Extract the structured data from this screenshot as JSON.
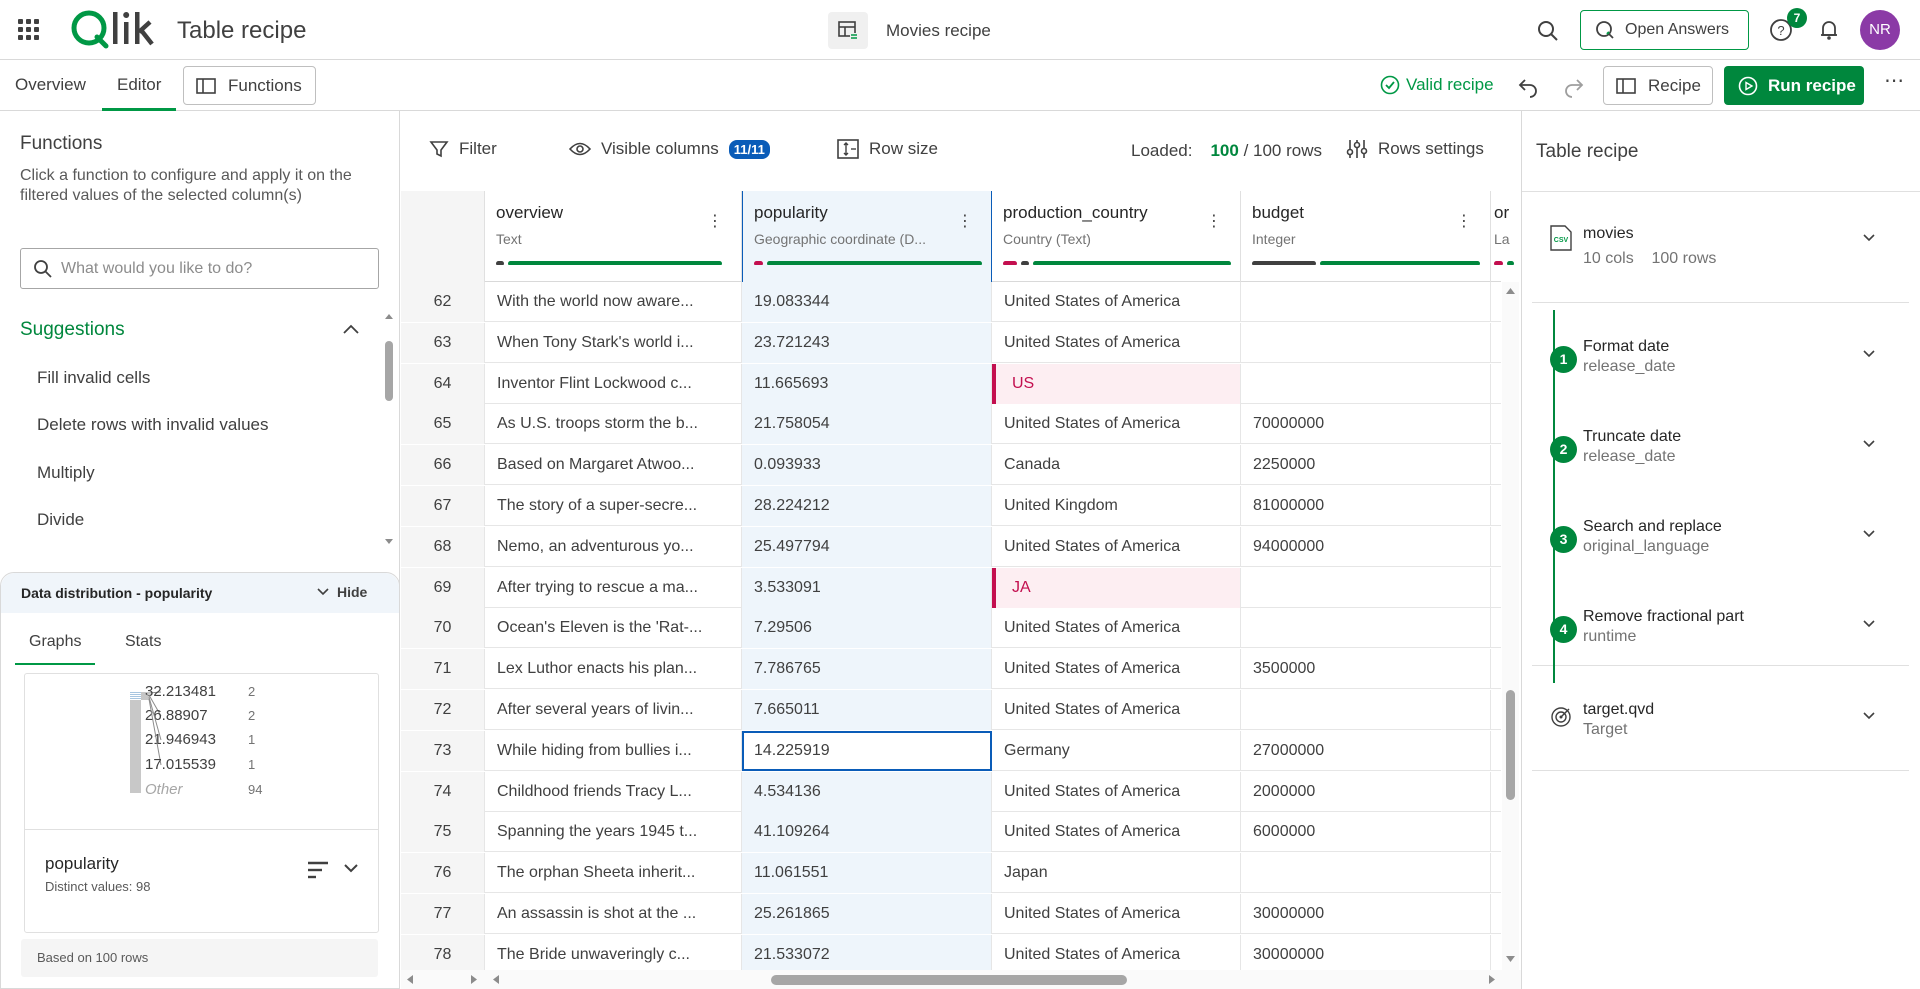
{
  "header": {
    "app_title": "Table recipe",
    "doc_title": "Movies recipe",
    "open_answers": "Open Answers",
    "help_badge": "7",
    "avatar_initials": "NR"
  },
  "subbar": {
    "tab_overview": "Overview",
    "tab_editor": "Editor",
    "functions": "Functions",
    "valid_recipe": "Valid recipe",
    "recipe": "Recipe",
    "run_recipe": "Run recipe"
  },
  "left_panel": {
    "title": "Functions",
    "description": "Click a function to configure and apply it on the filtered values of the selected column(s)",
    "search_placeholder": "What would you like to do?",
    "suggestions_label": "Suggestions",
    "suggestions": [
      "Fill invalid cells",
      "Delete rows with invalid values",
      "Multiply",
      "Divide"
    ]
  },
  "distribution": {
    "title": "Data distribution - popularity",
    "hide": "Hide",
    "tab_graphs": "Graphs",
    "tab_stats": "Stats",
    "field_name": "popularity",
    "distinct": "Distinct values: 98",
    "footer": "Based on 100 rows",
    "chart_data": {
      "type": "bar",
      "categories": [
        "32.213481",
        "26.88907",
        "21.946943",
        "17.015539",
        "Other"
      ],
      "values": [
        2,
        2,
        1,
        1,
        94
      ],
      "labels": [
        "2",
        "2",
        "1",
        "1",
        "94"
      ]
    }
  },
  "toolbar": {
    "filter": "Filter",
    "visible_columns": "Visible columns",
    "visible_badge": "11/11",
    "row_size": "Row size",
    "loaded_label": "Loaded:",
    "loaded_count": "100",
    "loaded_total": "/ 100 rows",
    "rows_settings": "Rows settings"
  },
  "columns": [
    {
      "name": "overview",
      "type": "Text"
    },
    {
      "name": "popularity",
      "type": "Geographic coordinate (D..."
    },
    {
      "name": "production_country",
      "type": "Country (Text)"
    },
    {
      "name": "budget",
      "type": "Integer"
    },
    {
      "name": "or",
      "type": "La"
    }
  ],
  "rows": [
    {
      "num": "62",
      "overview": "With the world now aware...",
      "popularity": "19.083344",
      "country": "United States of America",
      "budget": ""
    },
    {
      "num": "63",
      "overview": "When Tony Stark's world i...",
      "popularity": "23.721243",
      "country": "United States of America",
      "budget": ""
    },
    {
      "num": "64",
      "overview": "Inventor Flint Lockwood c...",
      "popularity": "11.665693",
      "country": "US",
      "budget": ""
    },
    {
      "num": "65",
      "overview": "As U.S. troops storm the b...",
      "popularity": "21.758054",
      "country": "United States of America",
      "budget": "70000000"
    },
    {
      "num": "66",
      "overview": "Based on Margaret Atwoo...",
      "popularity": "0.093933",
      "country": "Canada",
      "budget": "2250000"
    },
    {
      "num": "67",
      "overview": "The story of a super-secre...",
      "popularity": "28.224212",
      "country": "United Kingdom",
      "budget": "81000000"
    },
    {
      "num": "68",
      "overview": "Nemo, an adventurous yo...",
      "popularity": "25.497794",
      "country": "United States of America",
      "budget": "94000000"
    },
    {
      "num": "69",
      "overview": "After trying to rescue a ma...",
      "popularity": "3.533091",
      "country": "JA",
      "budget": ""
    },
    {
      "num": "70",
      "overview": "Ocean's Eleven is the 'Rat-...",
      "popularity": "7.29506",
      "country": "United States of America",
      "budget": ""
    },
    {
      "num": "71",
      "overview": "Lex Luthor enacts his plan...",
      "popularity": "7.786765",
      "country": "United States of America",
      "budget": "3500000"
    },
    {
      "num": "72",
      "overview": "After several years of livin...",
      "popularity": "7.665011",
      "country": "United States of America",
      "budget": ""
    },
    {
      "num": "73",
      "overview": "While hiding from bullies i...",
      "popularity": "14.225919",
      "country": "Germany",
      "budget": "27000000"
    },
    {
      "num": "74",
      "overview": "Childhood friends Tracy L...",
      "popularity": "4.534136",
      "country": "United States of America",
      "budget": "2000000"
    },
    {
      "num": "75",
      "overview": "Spanning the years 1945 t...",
      "popularity": "41.109264",
      "country": "United States of America",
      "budget": "6000000"
    },
    {
      "num": "76",
      "overview": "The orphan Sheeta inherit...",
      "popularity": "11.061551",
      "country": "Japan",
      "budget": ""
    },
    {
      "num": "77",
      "overview": "An assassin is shot at the ...",
      "popularity": "25.261865",
      "country": "United States of America",
      "budget": "30000000"
    },
    {
      "num": "78",
      "overview": "The Bride unwaveringly c...",
      "popularity": "21.533072",
      "country": "United States of America",
      "budget": "30000000"
    }
  ],
  "right_panel": {
    "title": "Table recipe",
    "source": {
      "name": "movies",
      "cols": "10 cols",
      "rows": "100 rows",
      "icon_text": "CSV"
    },
    "steps": [
      {
        "num": "1",
        "name": "Format date",
        "sub": "release_date"
      },
      {
        "num": "2",
        "name": "Truncate date",
        "sub": "release_date"
      },
      {
        "num": "3",
        "name": "Search and replace",
        "sub": "original_language"
      },
      {
        "num": "4",
        "name": "Remove fractional part",
        "sub": "runtime"
      }
    ],
    "target": {
      "name": "target.qvd",
      "sub": "Target"
    }
  },
  "colors": {
    "accent": "#009845",
    "run_button": "#00873d",
    "invalid": "#c30f4f",
    "selection": "#0a5cb8",
    "avatar": "#8b3aa6"
  }
}
